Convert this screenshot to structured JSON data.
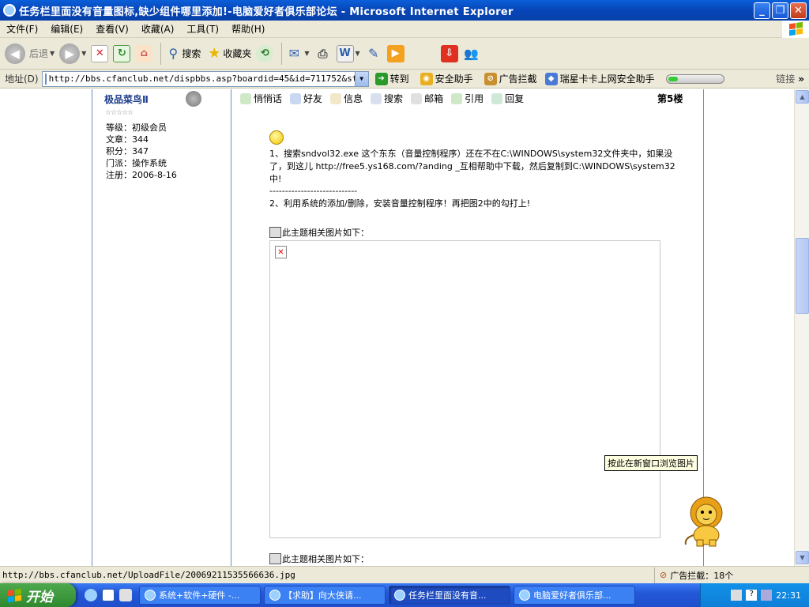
{
  "window": {
    "title": "任务栏里面没有音量图标,缺少组件哪里添加!-电脑爱好者俱乐部论坛 - Microsoft Internet Explorer"
  },
  "menu": [
    "文件(F)",
    "编辑(E)",
    "查看(V)",
    "收藏(A)",
    "工具(T)",
    "帮助(H)"
  ],
  "toolbar": {
    "back": "后退",
    "search": "搜索",
    "favorites": "收藏夹"
  },
  "addressbar": {
    "label": "地址(D)",
    "url": "http://bbs.cfanclub.net/dispbbs.asp?boardid=45&id=711752&star=",
    "go": "转到",
    "links": [
      "安全助手",
      "广告拦截",
      "瑞星卡卡上网安全助手"
    ],
    "links_label": "链接"
  },
  "user": {
    "name": "极品菜鸟Ⅱ",
    "stars": "☆☆☆☆☆",
    "level": "等级：初级会员",
    "posts": "文章：344",
    "points": "积分：347",
    "faction": "门派：操作系统",
    "registered": "注册：2006-8-16"
  },
  "postbar": {
    "items": [
      "悄悄话",
      "好友",
      "信息",
      "搜索",
      "邮箱",
      "引用",
      "回复"
    ],
    "floor": "第5楼"
  },
  "post": {
    "line1": "1、搜索sndvol32.exe 这个东东（音量控制程序）还在不在C:\\WINDOWS\\system32文件夹中，如果没了，到这儿 http://free5.ys168.com/?anding _互相帮助中下载，然后复制到C:\\WINDOWS\\system32中!",
    "divider": "----------------------------",
    "line2": "2、利用系统的添加/删除，安装音量控制程序！再把图2中的勾打上!",
    "caption1": "此主题相关图片如下：",
    "caption2": "此主题相关图片如下：",
    "tooltip": "按此在新窗口浏览图片"
  },
  "status": {
    "url": "http://bbs.cfanclub.net/UploadFile/20069211535566636.jpg",
    "adblock": "广告拦截：18个"
  },
  "taskbar": {
    "start": "开始",
    "tasks": [
      "系统+软件+硬件 -...",
      "【求助】向大侠请...",
      "任务栏里面没有音...",
      "电脑爱好者俱乐部..."
    ],
    "active_task": 2,
    "clock": "22:31"
  }
}
